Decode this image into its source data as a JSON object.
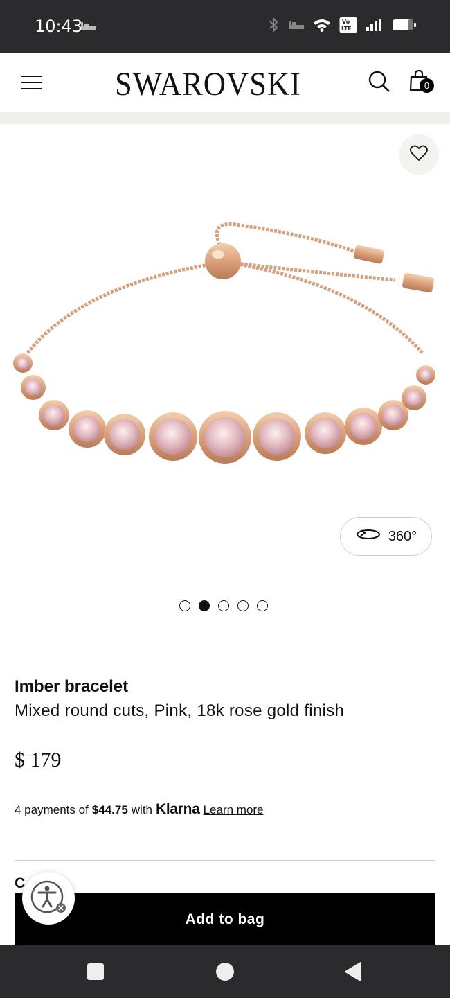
{
  "status_bar": {
    "time": "10:43",
    "icons": [
      "sleep-icon",
      "bluetooth-icon",
      "sleep-icon",
      "wifi-icon",
      "volte-icon",
      "signal-icon",
      "battery-icon"
    ],
    "volte_label": "Vo LTE"
  },
  "header": {
    "brand": "SWAROVSKI",
    "cart_count": "0",
    "band_color": "#f1efea"
  },
  "gallery": {
    "view_360_label": "360°",
    "dots_total": 5,
    "active_dot": 2
  },
  "product": {
    "name": "Imber bracelet",
    "description": "Mixed round cuts, Pink, 18k rose gold finish",
    "price": "$ 179"
  },
  "klarna": {
    "prefix": "4 payments of",
    "amount": "$44.75",
    "with": "with",
    "brand": "Klarna",
    "link": "Learn more"
  },
  "section_cut_label": "C",
  "cta": {
    "add_to_bag": "Add to bag"
  },
  "colors": {
    "brand_black": "#000000",
    "rose_gold": "#d9a07a",
    "crystal_pink": "#e8c4c8"
  }
}
